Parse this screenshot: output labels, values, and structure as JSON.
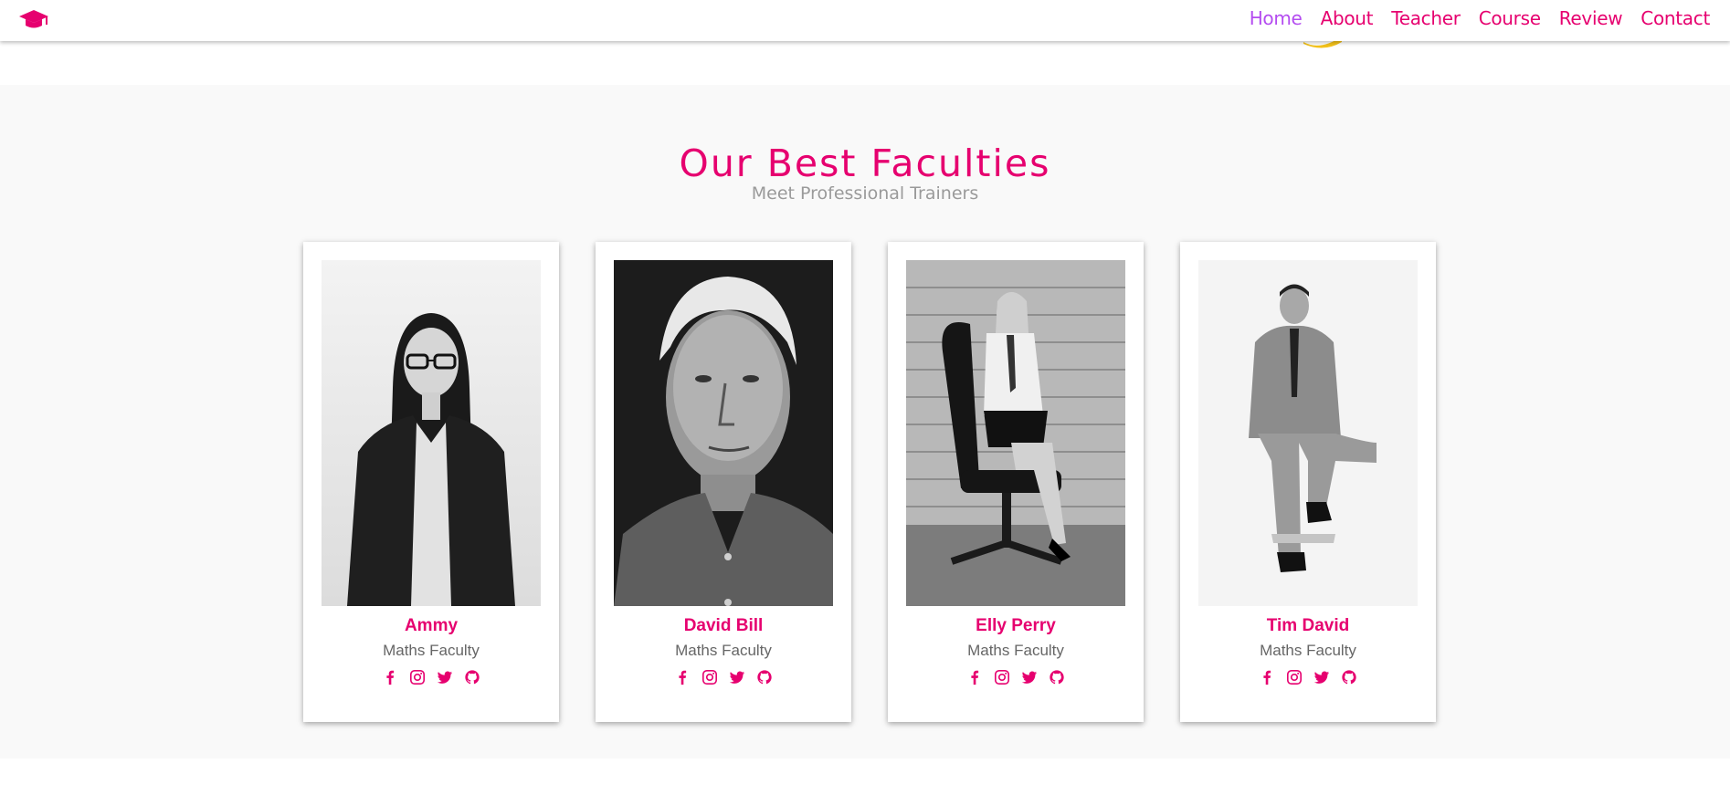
{
  "nav": {
    "brand_icon": "graduation-cap-icon",
    "links": [
      {
        "label": "Home",
        "active": true
      },
      {
        "label": "About",
        "active": false
      },
      {
        "label": "Teacher",
        "active": false
      },
      {
        "label": "Course",
        "active": false
      },
      {
        "label": "Review",
        "active": false
      },
      {
        "label": "Contact",
        "active": false
      }
    ]
  },
  "faculty": {
    "title": "Our Best Faculties",
    "subtitle": "Meet Professional Trainers",
    "cards": [
      {
        "name": "Ammy",
        "role": "Maths Faculty"
      },
      {
        "name": "David Bill",
        "role": "Maths Faculty"
      },
      {
        "name": "Elly Perry",
        "role": "Maths Faculty"
      },
      {
        "name": "Tim David",
        "role": "Maths Faculty"
      }
    ],
    "social_icons": [
      "facebook-icon",
      "instagram-icon",
      "twitter-icon",
      "github-icon"
    ]
  },
  "colors": {
    "accent": "#e6006f",
    "active_nav": "#b44cf0",
    "section_bg": "#f9f9f9",
    "muted_text": "#9a9a9a"
  }
}
